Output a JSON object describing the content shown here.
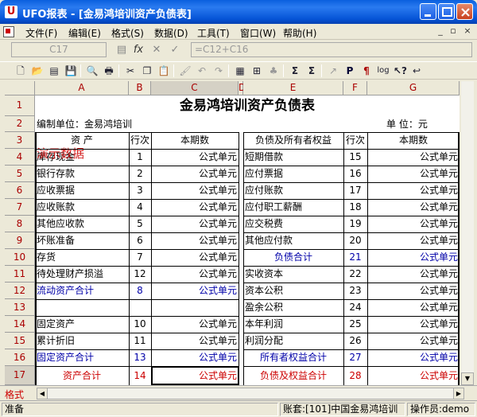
{
  "window": {
    "title": "UFO报表 - [金易鸿培训资产负债表]"
  },
  "menu": {
    "items": [
      "文件(F)",
      "编辑(E)",
      "格式(S)",
      "数据(D)",
      "工具(T)",
      "窗口(W)",
      "帮助(H)"
    ],
    "mdi_controls": [
      "_",
      "▫",
      "×"
    ]
  },
  "formula_bar": {
    "cell_ref": "C17",
    "formula": "=C12+C16"
  },
  "toolbar": {
    "icons": [
      "new-file-icon",
      "open-folder-icon",
      "new-sheet-icon",
      "save-icon",
      "print-preview-icon",
      "print-icon",
      "cut-icon",
      "copy-icon",
      "paste-icon",
      "format-painter-icon",
      "undo-icon",
      "redo-icon",
      "insert-table-icon",
      "grid-icon",
      "chart-icon",
      "sum-icon",
      "sum-dropdown-icon",
      "formula-icon",
      "p-icon",
      "bold-icon",
      "log-icon",
      "help-pointer-icon",
      "back-icon"
    ]
  },
  "grid": {
    "columns": [
      "A",
      "B",
      "C",
      "D",
      "E",
      "F",
      "G"
    ],
    "rows": [
      "1",
      "2",
      "3",
      "4",
      "5",
      "6",
      "7",
      "8",
      "9",
      "10",
      "11",
      "12",
      "13",
      "14",
      "15",
      "16",
      "17"
    ],
    "title": "金易鸿培训资产负债表",
    "compiler_label": "编制单位：金易鸿培训",
    "unit_label": "单  位：元",
    "header": [
      "资    产",
      "行次",
      "本期数",
      "负债及所有者权益",
      "行次",
      "本期数"
    ],
    "demo_watermark": "演示数据",
    "body": [
      {
        "asset": "库存现金",
        "n1": "1",
        "v1": "公式单元",
        "liab": "短期借款",
        "n2": "15",
        "v2": "公式单元"
      },
      {
        "asset": "银行存款",
        "n1": "2",
        "v1": "公式单元",
        "liab": "应付票据",
        "n2": "16",
        "v2": "公式单元"
      },
      {
        "asset": "应收票据",
        "n1": "3",
        "v1": "公式单元",
        "liab": "应付账款",
        "n2": "17",
        "v2": "公式单元"
      },
      {
        "asset": "应收账款",
        "n1": "4",
        "v1": "公式单元",
        "liab": "应付职工薪酬",
        "n2": "18",
        "v2": "公式单元"
      },
      {
        "asset": "其他应收款",
        "n1": "5",
        "v1": "公式单元",
        "liab": "应交税费",
        "n2": "19",
        "v2": "公式单元"
      },
      {
        "asset": "坏账准备",
        "n1": "6",
        "v1": "公式单元",
        "liab": "其他应付款",
        "n2": "20",
        "v2": "公式单元"
      },
      {
        "asset": "存货",
        "n1": "7",
        "v1": "公式单元",
        "liab": "负债合计",
        "n2": "21",
        "v2": "公式单元"
      },
      {
        "asset": "待处理财产损溢",
        "n1": "12",
        "v1": "公式单元",
        "liab": "实收资本",
        "n2": "22",
        "v2": "公式单元"
      },
      {
        "asset": "流动资产合计",
        "n1": "8",
        "v1": "公式单元",
        "liab": "资本公积",
        "n2": "23",
        "v2": "公式单元"
      },
      {
        "asset": "",
        "n1": "",
        "v1": "",
        "liab": "盈余公积",
        "n2": "24",
        "v2": "公式单元"
      },
      {
        "asset": "固定资产",
        "n1": "10",
        "v1": "公式单元",
        "liab": "本年利润",
        "n2": "25",
        "v2": "公式单元"
      },
      {
        "asset": "累计折旧",
        "n1": "11",
        "v1": "公式单元",
        "liab": "利润分配",
        "n2": "26",
        "v2": "公式单元"
      },
      {
        "asset": "固定资产合计",
        "n1": "13",
        "v1": "公式单元",
        "liab": "所有者权益合计",
        "n2": "27",
        "v2": "公式单元"
      },
      {
        "asset": "资产合计",
        "n1": "14",
        "v1": "公式单元",
        "liab": "负债及权益合计",
        "n2": "28",
        "v2": "公式单元"
      }
    ]
  },
  "sheet_tab": "格式",
  "status": {
    "ready": "准备",
    "account": "账套:[101]中国金易鸿培训",
    "operator": "操作员:demo"
  },
  "colors": {
    "titlebar": "#0a5fde",
    "header_text": "#aa0000",
    "subtotal": "#0000a8",
    "total": "#cc0000"
  }
}
